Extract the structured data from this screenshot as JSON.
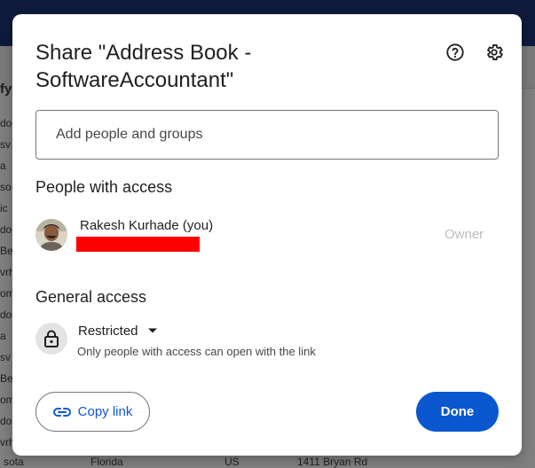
{
  "background": {
    "header_fragment": "fy",
    "row_fragments": [
      "do",
      "sv",
      "a",
      "so",
      "ic",
      "do",
      "Be",
      "vrh",
      "om",
      "do",
      "a",
      "sv",
      "Be",
      "om",
      "do",
      "vrh"
    ],
    "bottom_row": [
      "sota",
      "Florida",
      "US",
      "1411 Bryan Rd"
    ]
  },
  "dialog": {
    "title": "Share \"Address Book - SoftwareAccountant\"",
    "help_icon": "help-circle-icon",
    "settings_icon": "gear-icon",
    "add_people": {
      "placeholder": "Add people and groups",
      "value": ""
    },
    "people_section_title": "People with access",
    "people": [
      {
        "name": "Rakesh Kurhade (you)",
        "role": "Owner"
      }
    ],
    "general_access_title": "General access",
    "general_access": {
      "icon": "lock-icon",
      "selected": "Restricted",
      "description": "Only people with access can open with the link"
    },
    "copy_link_label": "Copy link",
    "done_label": "Done"
  },
  "colors": {
    "accent": "#0b57d0",
    "redaction": "#ff0000"
  }
}
